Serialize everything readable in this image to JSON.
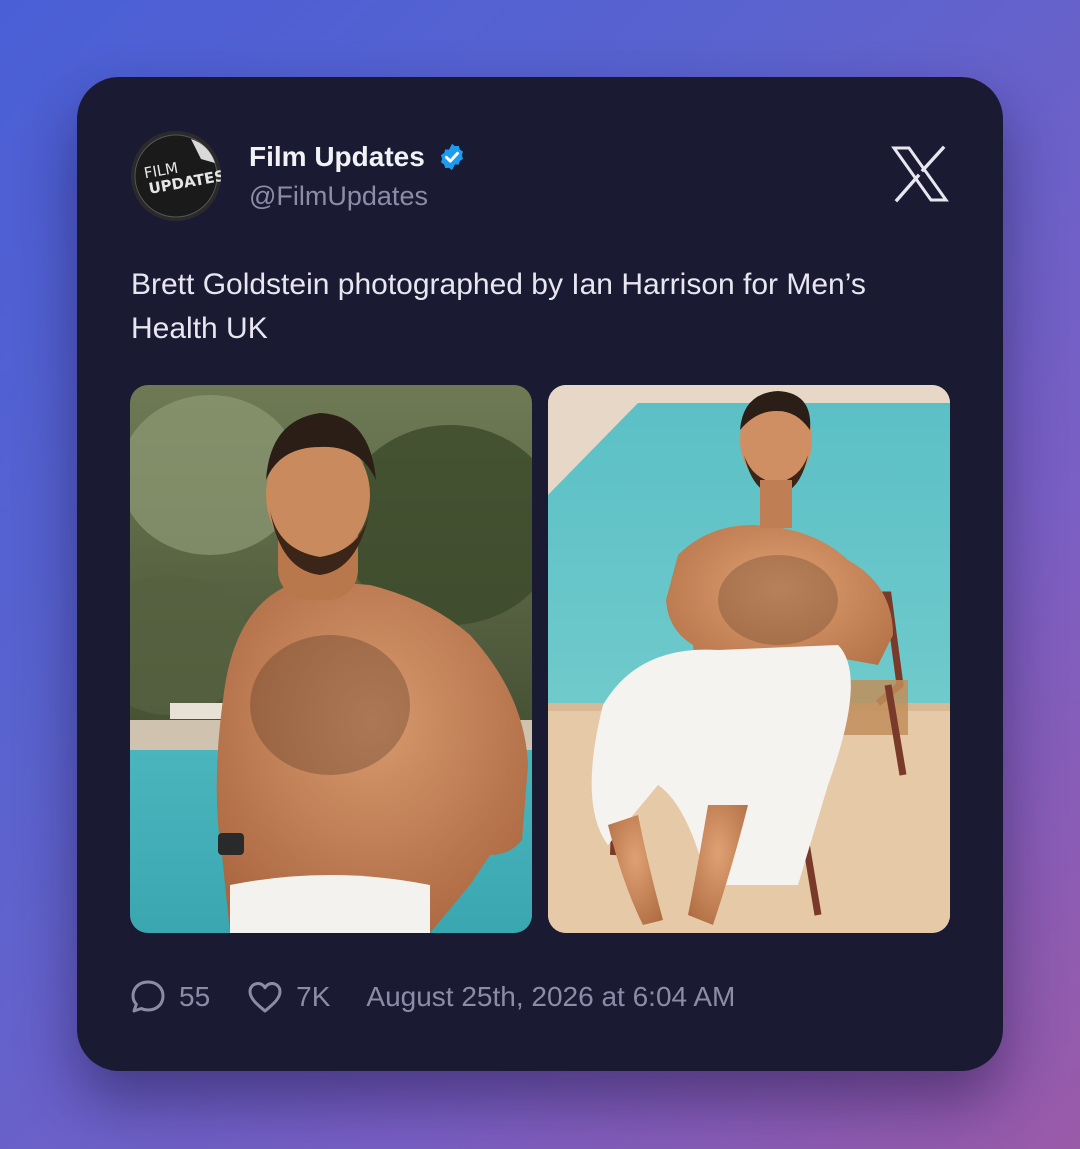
{
  "account": {
    "avatar_text_line1": "FILM",
    "avatar_text_line2": "UPDATES",
    "name": "Film Updates",
    "handle": "@FilmUpdates",
    "verified": true
  },
  "tweet": {
    "text": "Brett Goldstein photographed by Ian Harrison for Men’s Health UK"
  },
  "media": [
    {
      "description_icon": "photo-poolside-standing"
    },
    {
      "description_icon": "photo-poolside-chair"
    }
  ],
  "stats": {
    "replies": "55",
    "likes": "7K",
    "timestamp": "August 25th, 2026 at 6:04 AM"
  },
  "colors": {
    "card_bg": "#1b1a33",
    "verified": "#1d9bf0",
    "muted_text": "#8d8ca6"
  }
}
